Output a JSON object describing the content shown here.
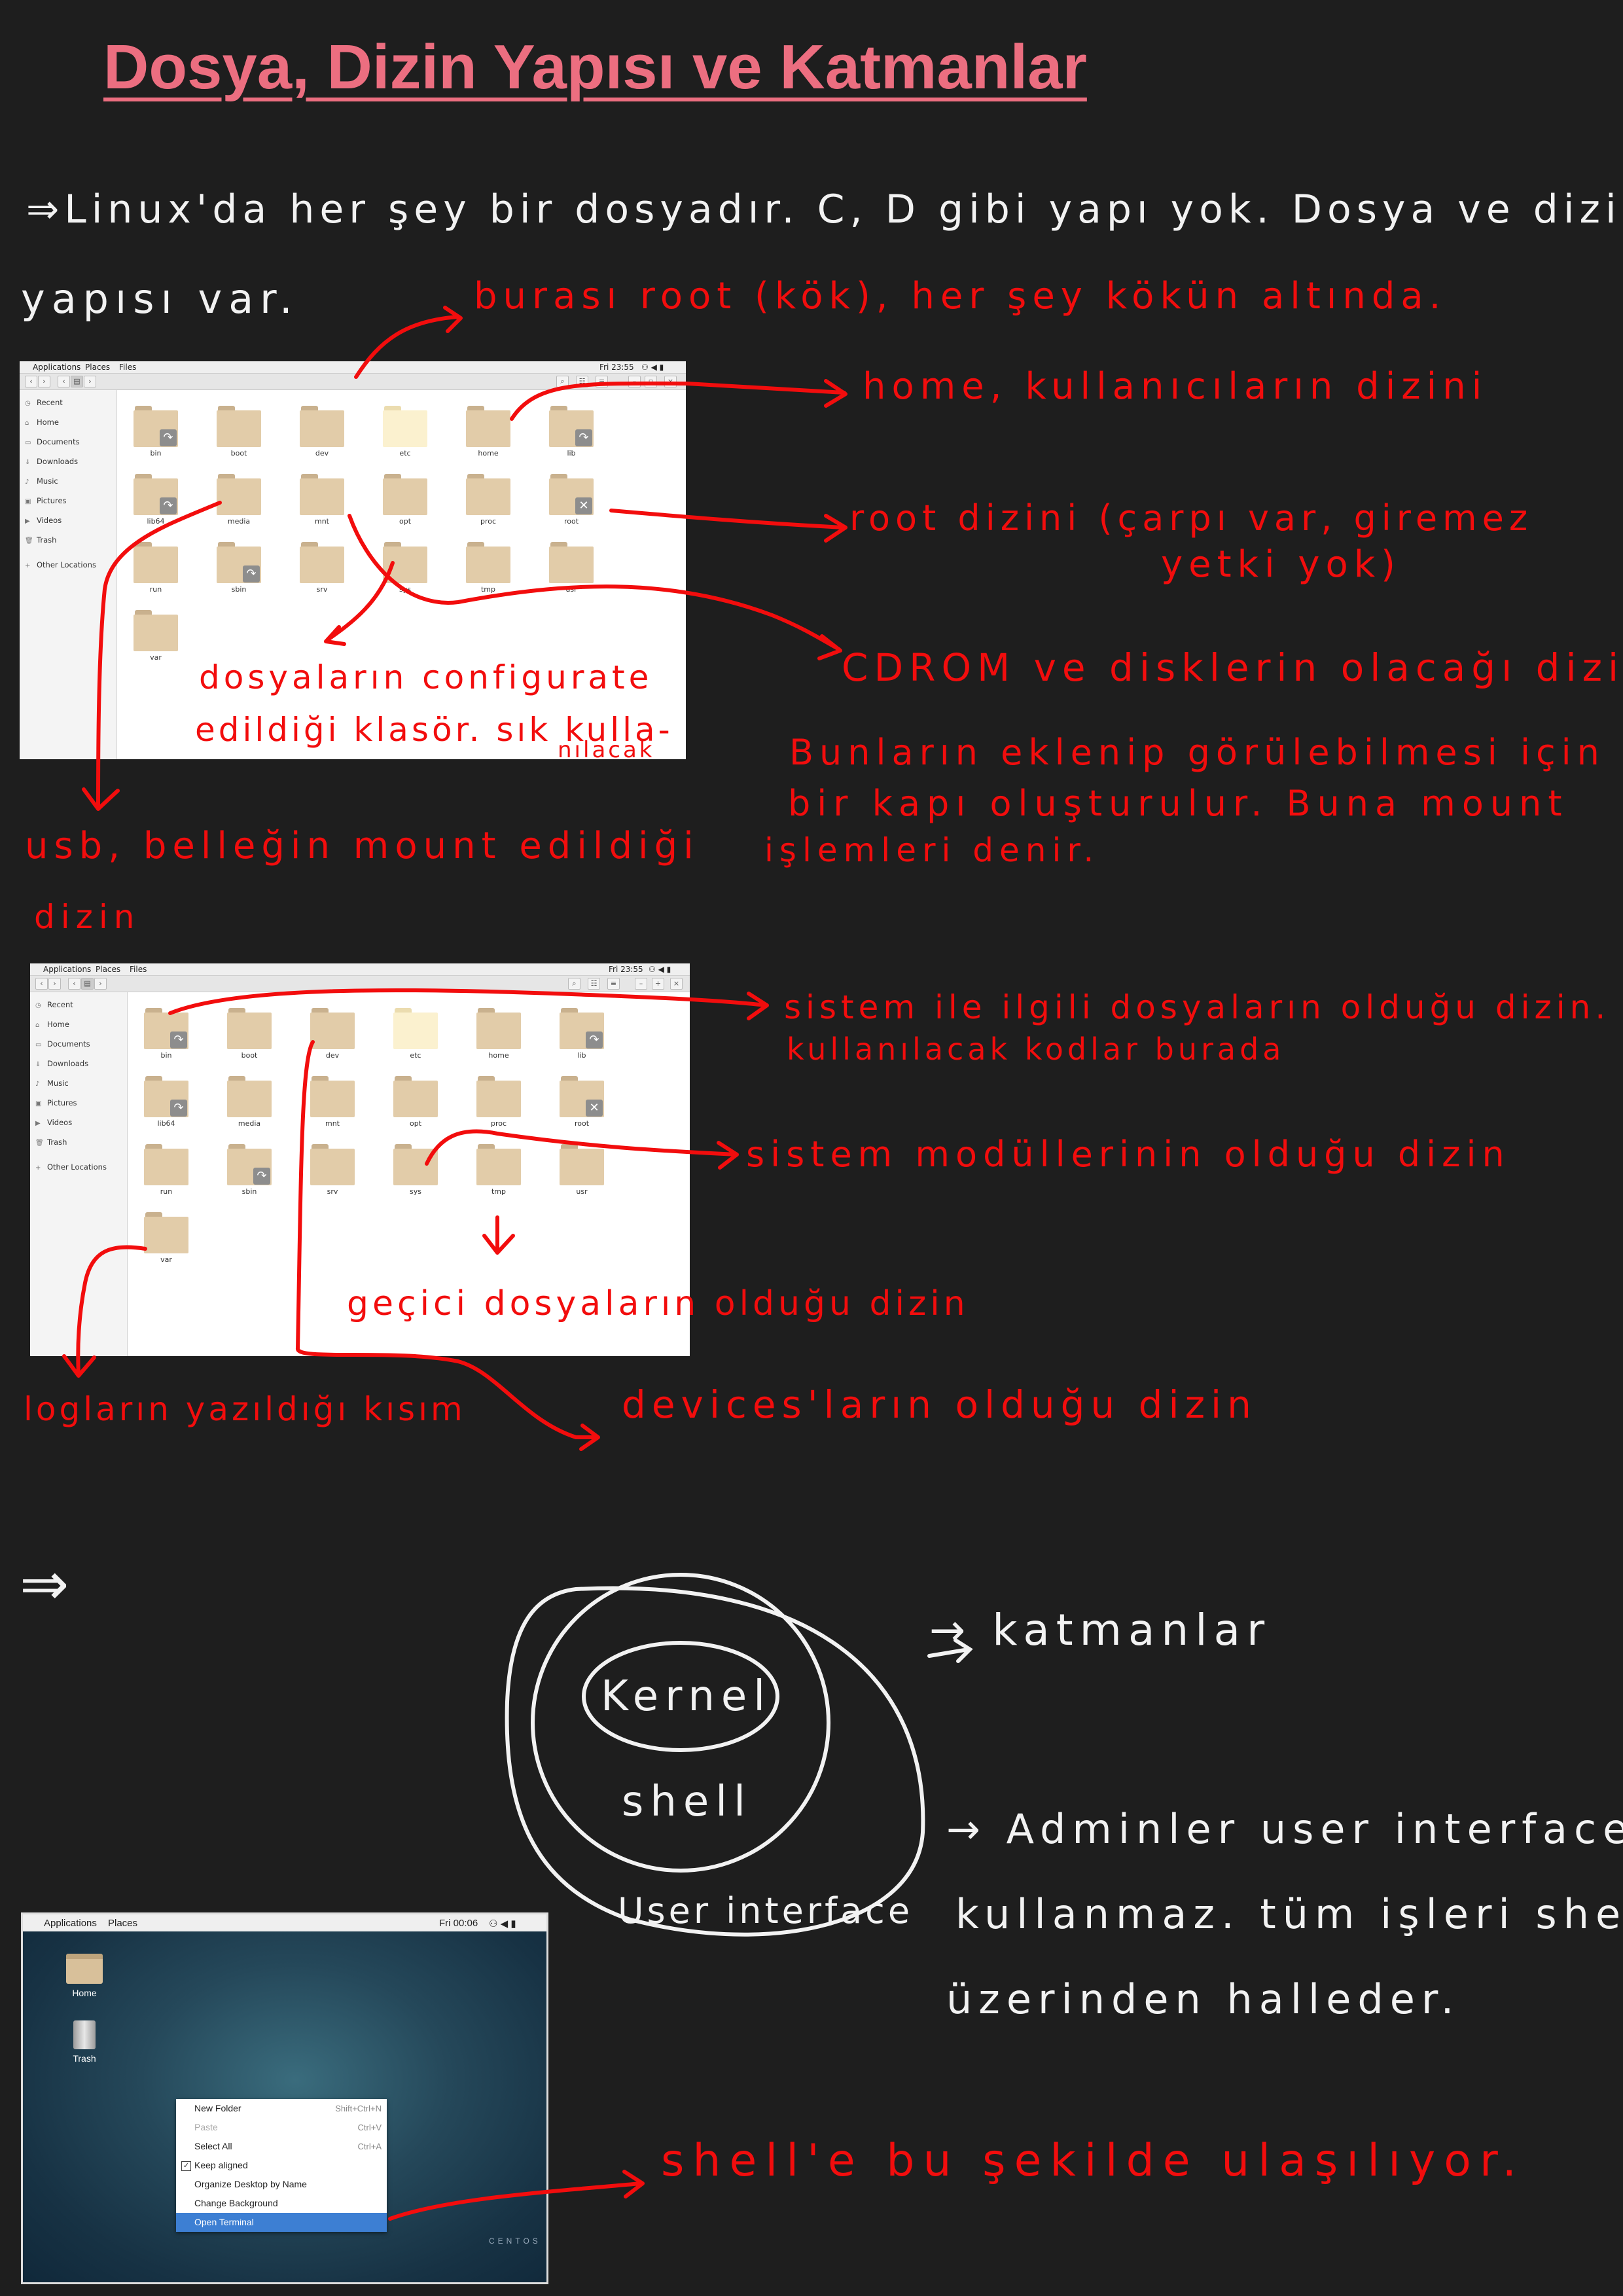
{
  "title": "Dosya, Dizin Yapısı ve Katmanlar",
  "notes": {
    "intro_line1": "⇒Linux'da her şey bir dosyadır. C, D gibi yapı yok. Dosya ve dizin",
    "intro_line2": "yapısı var.",
    "root_note": "burası root (kök), her şey kökün altında.",
    "home_note": "home, kullanıcıların dizini",
    "root_dir_line1": "root dizini (çarpı var, giremez",
    "root_dir_line2": "yetki yok)",
    "cdrom_note": "CDROM ve disklerin olacağı dizin",
    "mount_line1": "Bunların eklenip görülebilmesi için",
    "mount_line2": "bir kapı oluşturulur. Buna mount",
    "mount_line3": "işlemleri denir.",
    "etc_line1": "dosyaların configurate",
    "etc_line2": "edildiği klasör. sık kulla-",
    "etc_line3": "nılacak",
    "usb_line1": "usb, belleğin mount edildiği",
    "usb_line2": "dizin",
    "bin_line1": "sistem ile ilgili dosyaların olduğu dizin.",
    "bin_line2": "kullanılacak kodlar burada",
    "sys_note": "sistem modüllerinin olduğu dizin",
    "tmp_note": "geçici dosyaların olduğu dizin",
    "var_note": "logların yazıldığı kısım",
    "dev_note": "devices'ların olduğu dizin",
    "arrow2": "⇒",
    "layers_note": "→ katmanlar",
    "admin_line1": "→ Adminler user interface'i",
    "admin_line2": "kullanmaz. tüm işleri shell",
    "admin_line3": "üzerinden halleder.",
    "shell_access": "shell'e bu şekilde ulaşılıyor."
  },
  "layers": {
    "inner": "Kernel",
    "middle": "shell",
    "outer": "User interface"
  },
  "window1": {
    "menu": [
      "Applications",
      "Places",
      "Files"
    ],
    "clock": "Fri 23:55",
    "sidebar": [
      {
        "icon": "clock-icon",
        "label": "Recent"
      },
      {
        "icon": "home-icon",
        "label": "Home"
      },
      {
        "icon": "document-icon",
        "label": "Documents"
      },
      {
        "icon": "download-icon",
        "label": "Downloads"
      },
      {
        "icon": "music-icon",
        "label": "Music"
      },
      {
        "icon": "picture-icon",
        "label": "Pictures"
      },
      {
        "icon": "video-icon",
        "label": "Videos"
      },
      {
        "icon": "trash-icon",
        "label": "Trash"
      },
      {
        "icon": "plus-icon",
        "label": "Other Locations"
      }
    ],
    "folders": [
      {
        "name": "bin",
        "emblem": "link"
      },
      {
        "name": "boot",
        "emblem": ""
      },
      {
        "name": "dev",
        "emblem": ""
      },
      {
        "name": "etc",
        "emblem": "",
        "highlight": true
      },
      {
        "name": "home",
        "emblem": ""
      },
      {
        "name": "lib",
        "emblem": "link"
      },
      {
        "name": "lib64",
        "emblem": "link"
      },
      {
        "name": "media",
        "emblem": ""
      },
      {
        "name": "mnt",
        "emblem": ""
      },
      {
        "name": "opt",
        "emblem": ""
      },
      {
        "name": "proc",
        "emblem": ""
      },
      {
        "name": "root",
        "emblem": "locked"
      },
      {
        "name": "run",
        "emblem": ""
      },
      {
        "name": "sbin",
        "emblem": "link"
      },
      {
        "name": "srv",
        "emblem": ""
      },
      {
        "name": "sys",
        "emblem": ""
      },
      {
        "name": "tmp",
        "emblem": ""
      },
      {
        "name": "usr",
        "emblem": ""
      },
      {
        "name": "var",
        "emblem": ""
      }
    ]
  },
  "window2": {
    "menu": [
      "Applications",
      "Places",
      "Files"
    ],
    "clock": "Fri 23:55",
    "sidebar": [
      {
        "icon": "clock-icon",
        "label": "Recent"
      },
      {
        "icon": "home-icon",
        "label": "Home"
      },
      {
        "icon": "document-icon",
        "label": "Documents"
      },
      {
        "icon": "download-icon",
        "label": "Downloads"
      },
      {
        "icon": "music-icon",
        "label": "Music"
      },
      {
        "icon": "picture-icon",
        "label": "Pictures"
      },
      {
        "icon": "video-icon",
        "label": "Videos"
      },
      {
        "icon": "trash-icon",
        "label": "Trash"
      },
      {
        "icon": "plus-icon",
        "label": "Other Locations"
      }
    ],
    "folders": [
      {
        "name": "bin",
        "emblem": "link"
      },
      {
        "name": "boot",
        "emblem": ""
      },
      {
        "name": "dev",
        "emblem": ""
      },
      {
        "name": "etc",
        "emblem": "",
        "highlight": true
      },
      {
        "name": "home",
        "emblem": ""
      },
      {
        "name": "lib",
        "emblem": "link"
      },
      {
        "name": "lib64",
        "emblem": "link"
      },
      {
        "name": "media",
        "emblem": ""
      },
      {
        "name": "mnt",
        "emblem": ""
      },
      {
        "name": "opt",
        "emblem": ""
      },
      {
        "name": "proc",
        "emblem": ""
      },
      {
        "name": "root",
        "emblem": "locked"
      },
      {
        "name": "run",
        "emblem": ""
      },
      {
        "name": "sbin",
        "emblem": "link"
      },
      {
        "name": "srv",
        "emblem": ""
      },
      {
        "name": "sys",
        "emblem": ""
      },
      {
        "name": "tmp",
        "emblem": ""
      },
      {
        "name": "usr",
        "emblem": ""
      },
      {
        "name": "var",
        "emblem": ""
      }
    ]
  },
  "desktop": {
    "menu": [
      "Applications",
      "Places"
    ],
    "clock": "Fri 00:06",
    "icons": [
      {
        "icon": "home-folder-icon",
        "label": "Home"
      },
      {
        "icon": "trash-icon",
        "label": "Trash"
      }
    ],
    "context_menu": [
      {
        "label": "New Folder",
        "shortcut": "Shift+Ctrl+N",
        "state": "normal"
      },
      {
        "label": "Paste",
        "shortcut": "Ctrl+V",
        "state": "disabled"
      },
      {
        "label": "Select All",
        "shortcut": "Ctrl+A",
        "state": "normal"
      },
      {
        "label": "Keep aligned",
        "shortcut": "",
        "state": "checked"
      },
      {
        "label": "Organize Desktop by Name",
        "shortcut": "",
        "state": "normal"
      },
      {
        "label": "Change Background",
        "shortcut": "",
        "state": "normal"
      },
      {
        "label": "Open Terminal",
        "shortcut": "",
        "state": "selected"
      }
    ],
    "watermark": "CENTOS"
  },
  "colors": {
    "background": "#1e1e1e",
    "title": "#ec6e80",
    "ink_white": "#f2f2f2",
    "ink_red": "#f20d0d",
    "menu_selected": "#3d7fd3"
  }
}
